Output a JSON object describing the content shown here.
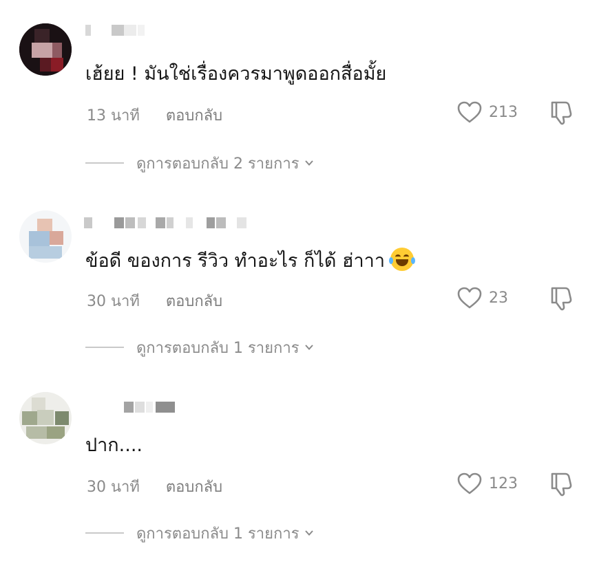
{
  "comments": [
    {
      "text": "เฮ้ยย ! มันใช่เรื่องควรมาพูดออกสื่อมั้ย",
      "time": "13 นาที",
      "reply_label": "ตอบกลับ",
      "likes": "213",
      "view_replies": "ดูการตอบกลับ 2 รายการ"
    },
    {
      "text": "ข้อดี ของการ รีวิว ทำอะไร ก็ได้ ฮ่าาา",
      "emoji": "face-with-tears-of-joy-icon",
      "time": "30 นาที",
      "reply_label": "ตอบกลับ",
      "likes": "23",
      "view_replies": "ดูการตอบกลับ 1 รายการ"
    },
    {
      "text": "ปาก....",
      "time": "30 นาที",
      "reply_label": "ตอบกลับ",
      "likes": "123",
      "view_replies": "ดูการตอบกลับ 1 รายการ"
    }
  ],
  "colors": {
    "text": "#161616",
    "meta": "#8a8a8a",
    "divider": "#c9c9c9"
  }
}
